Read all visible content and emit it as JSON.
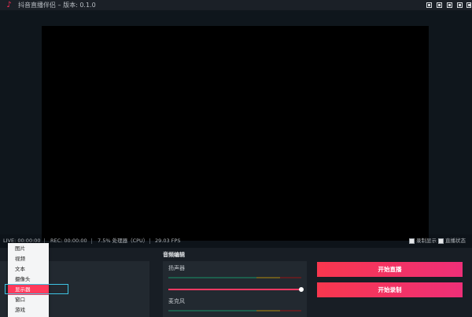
{
  "app": {
    "title": "抖音直播伴侣 – 版本: 0.1.0",
    "logo_icon": "tiktok-note-icon",
    "window_controls": [
      "window-control-1",
      "window-control-2",
      "window-control-3",
      "window-control-4",
      "window-control-5"
    ]
  },
  "status": {
    "live": "LIVE: 00:00:00",
    "rec": "REC: 00:00:00",
    "cpu": "7.5% 处理器（CPU）",
    "fps": "29.03 FPS",
    "record_display": "录制显示",
    "live_status": "直播状态"
  },
  "audio": {
    "section_title": "音频编辑",
    "speaker_label": "扬声器",
    "mic_label": "麦克风"
  },
  "actions": {
    "start_live": "开始直播",
    "start_record": "开始录制"
  },
  "source_menu": {
    "items": [
      "图片",
      "视频",
      "文本",
      "摄像头",
      "显示器",
      "窗口",
      "游戏"
    ],
    "selected_index": 4
  },
  "colors": {
    "accent": "#fe2c55",
    "highlight": "#3ec4e4"
  }
}
